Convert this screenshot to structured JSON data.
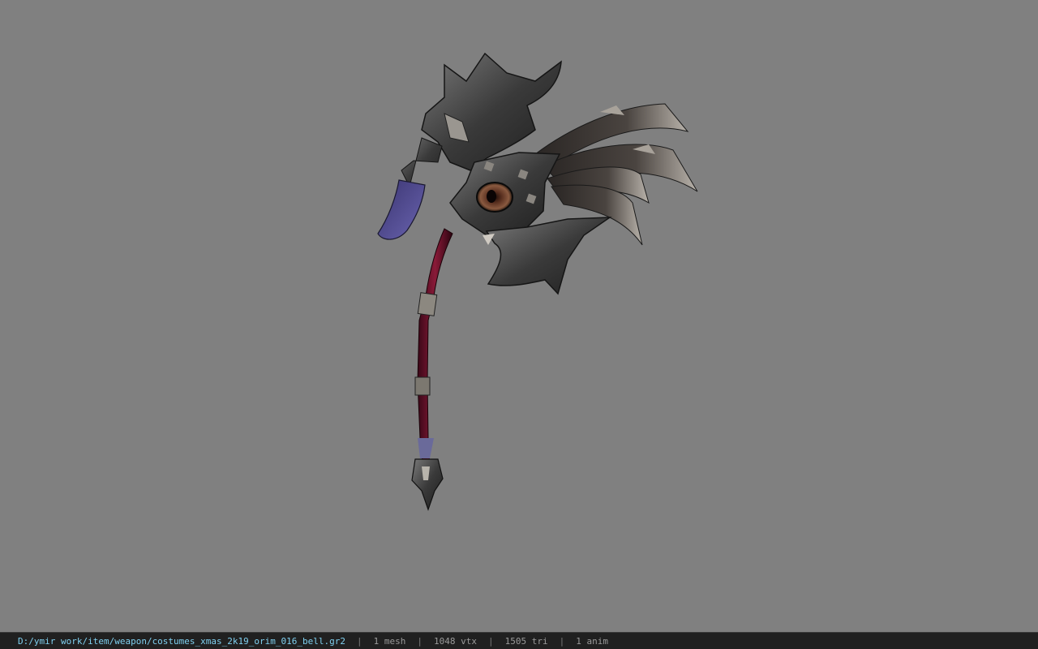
{
  "viewer": {
    "background_color": "#808080",
    "model_icon": "scythe-weapon-model"
  },
  "statusbar": {
    "file_path": "D:/ymir work/item/weapon/costumes_xmas_2k19_orim_016_bell.gr2",
    "separator": "|",
    "mesh_count": "1 mesh",
    "vertex_count": "1048 vtx",
    "triangle_count": "1505 tri",
    "anim_count": "1 anim"
  }
}
